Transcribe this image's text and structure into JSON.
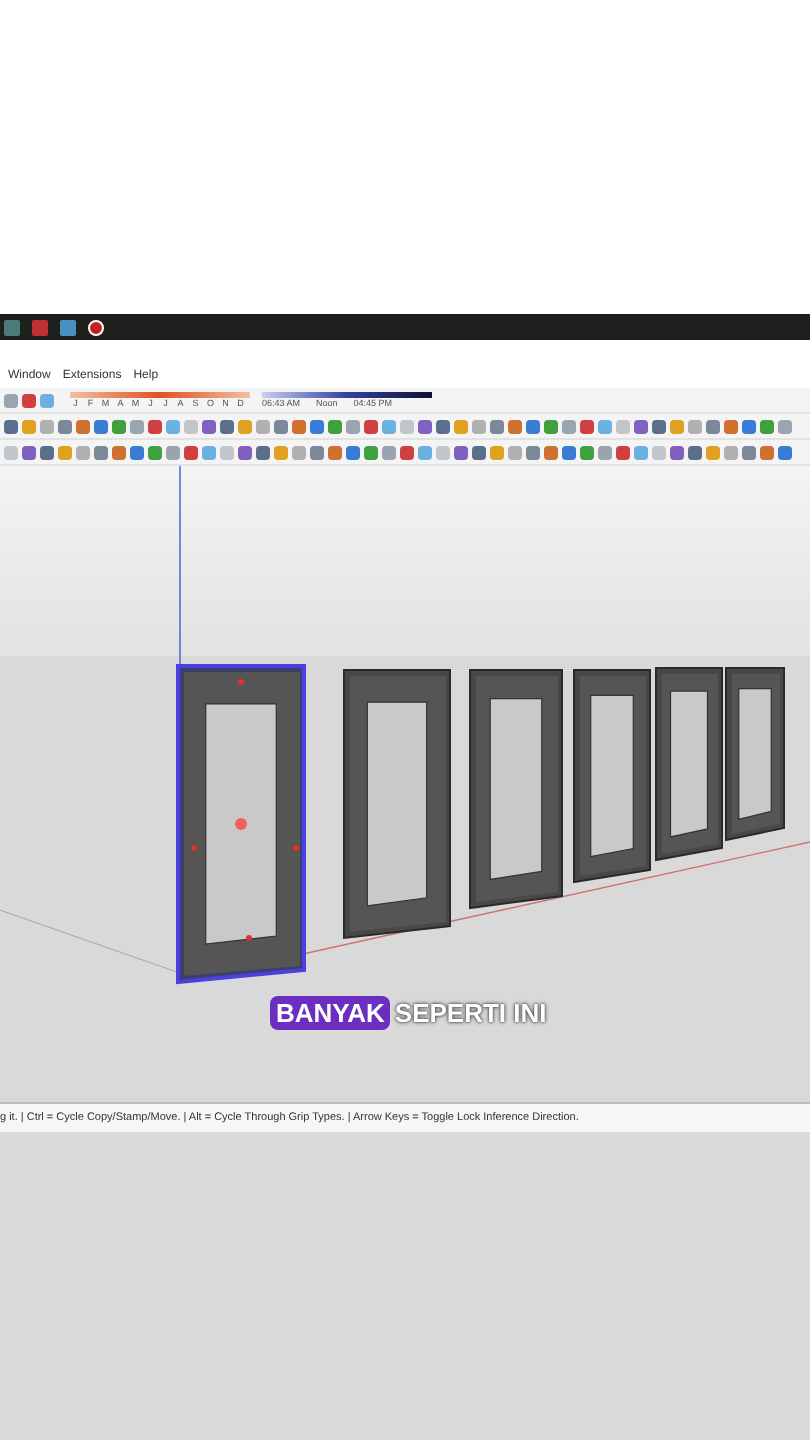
{
  "menu": [
    "Window",
    "Extensions",
    "Help"
  ],
  "shadow_timeline": {
    "months": [
      "J",
      "F",
      "M",
      "A",
      "M",
      "J",
      "J",
      "A",
      "S",
      "O",
      "N",
      "D"
    ],
    "sunrise": "06:43 AM",
    "noon": "Noon",
    "sunset": "04:45 PM"
  },
  "caption": {
    "highlight": "BANYAK",
    "rest": "SEPERTI INI"
  },
  "status_bar": "g it. | Ctrl = Cycle Copy/Stamp/Move. | Alt = Cycle Through Grip Types. | Arrow Keys = Toggle Lock Inference Direction."
}
